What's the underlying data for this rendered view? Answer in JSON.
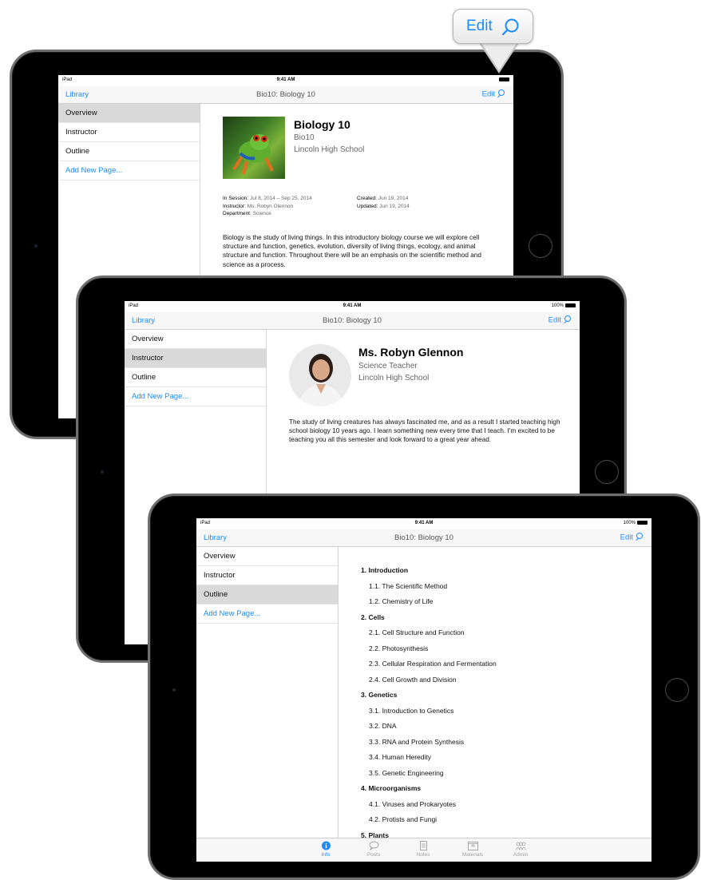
{
  "callout": {
    "label": "Edit"
  },
  "screen1": {
    "status": {
      "device": "iPad",
      "time": "9:41 AM",
      "battery": ""
    },
    "nav": {
      "library": "Library",
      "title": "Bio10: Biology 10",
      "edit": "Edit"
    },
    "sidebar": [
      {
        "label": "Overview"
      },
      {
        "label": "Instructor"
      },
      {
        "label": "Outline"
      },
      {
        "label": "Add New Page..."
      }
    ],
    "course": {
      "title": "Biology 10",
      "code": "Bio10",
      "school": "Lincoln High School",
      "session_key": "In Session:",
      "session_val": "Jul 8, 2014 – Sep 25, 2014",
      "instructor_key": "Instructor:",
      "instructor_val": "Ms. Robyn Glennon",
      "department_key": "Department:",
      "department_val": "Science",
      "created_key": "Created:",
      "created_val": "Jun 19, 2014",
      "updated_key": "Updated:",
      "updated_val": "Jun 19, 2014",
      "description": "Biology is the study of living things. In this introductory biology course we will explore cell structure and function, genetics, evolution, diversity of living things, ecology, and animal structure and function. Throughout there will be an emphasis on the scientific method and science as a process."
    }
  },
  "screen2": {
    "status": {
      "device": "iPad",
      "time": "9:41 AM",
      "battery": "100%"
    },
    "nav": {
      "library": "Library",
      "title": "Bio10: Biology 10",
      "edit": "Edit"
    },
    "sidebar": [
      {
        "label": "Overview"
      },
      {
        "label": "Instructor"
      },
      {
        "label": "Outline"
      },
      {
        "label": "Add New Page..."
      }
    ],
    "instructor": {
      "name": "Ms. Robyn Glennon",
      "role": "Science Teacher",
      "school": "Lincoln High School",
      "bio": "The study of living creatures has always fascinated me, and as a result I started teaching high school biology 10 years ago. I learn something new every time that I teach. I'm excited to be teaching you all this semester and look forward to a great year ahead."
    }
  },
  "screen3": {
    "status": {
      "device": "iPad",
      "time": "9:41 AM",
      "battery": "100%"
    },
    "nav": {
      "library": "Library",
      "title": "Bio10: Biology 10",
      "edit": "Edit"
    },
    "sidebar": [
      {
        "label": "Overview"
      },
      {
        "label": "Instructor"
      },
      {
        "label": "Outline"
      },
      {
        "label": "Add New Page..."
      }
    ],
    "outline": [
      {
        "num": "1.",
        "title": "Introduction",
        "items": [
          {
            "num": "1.1.",
            "title": "The Scientific Method"
          },
          {
            "num": "1.2.",
            "title": "Chemistry of Life"
          }
        ]
      },
      {
        "num": "2.",
        "title": "Cells",
        "items": [
          {
            "num": "2.1.",
            "title": "Cell Structure and Function"
          },
          {
            "num": "2.2.",
            "title": "Photosynthesis"
          },
          {
            "num": "2.3.",
            "title": "Cellular Respiration and Fermentation"
          },
          {
            "num": "2.4.",
            "title": "Cell Growth and Division"
          }
        ]
      },
      {
        "num": "3.",
        "title": "Genetics",
        "items": [
          {
            "num": "3.1.",
            "title": "Introduction to Genetics"
          },
          {
            "num": "3.2.",
            "title": "DNA"
          },
          {
            "num": "3.3.",
            "title": "RNA and Protein Synthesis"
          },
          {
            "num": "3.4.",
            "title": "Human Heredity"
          },
          {
            "num": "3.5.",
            "title": "Genetic Engineering"
          }
        ]
      },
      {
        "num": "4.",
        "title": "Microorganisms",
        "items": [
          {
            "num": "4.1.",
            "title": "Viruses and Prokaryotes"
          },
          {
            "num": "4.2.",
            "title": "Protists and Fungi"
          }
        ]
      },
      {
        "num": "5.",
        "title": "Plants",
        "items": []
      }
    ],
    "tabs": [
      {
        "label": "Info",
        "icon": "info-icon"
      },
      {
        "label": "Posts",
        "icon": "chat-bubble-icon"
      },
      {
        "label": "Notes",
        "icon": "note-icon"
      },
      {
        "label": "Materials",
        "icon": "box-icon"
      },
      {
        "label": "Admin",
        "icon": "people-icon"
      }
    ]
  },
  "colors": {
    "accent": "#1a8cff",
    "selected_row": "#d9d9d9",
    "device": "#000000"
  }
}
